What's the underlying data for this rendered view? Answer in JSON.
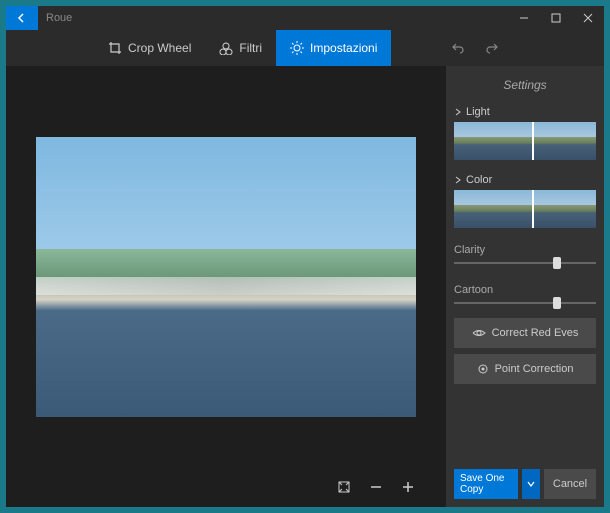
{
  "titlebar": {
    "title": "Roue"
  },
  "toolbar": {
    "crop_label": "Crop Wheel",
    "filters_label": "Filtri",
    "settings_label": "Impostazioni"
  },
  "sidebar": {
    "title": "Settings",
    "light_label": "Light",
    "color_label": "Color",
    "clarity_label": "Clarity",
    "cartoon_label": "Cartoon",
    "clarity_value": 70,
    "cartoon_value": 70,
    "redeye_label": "Correct Red Eves",
    "point_label": "Point Correction"
  },
  "footer": {
    "save_line1": "Save One",
    "save_line2": "Copy",
    "cancel_label": "Cancel"
  }
}
